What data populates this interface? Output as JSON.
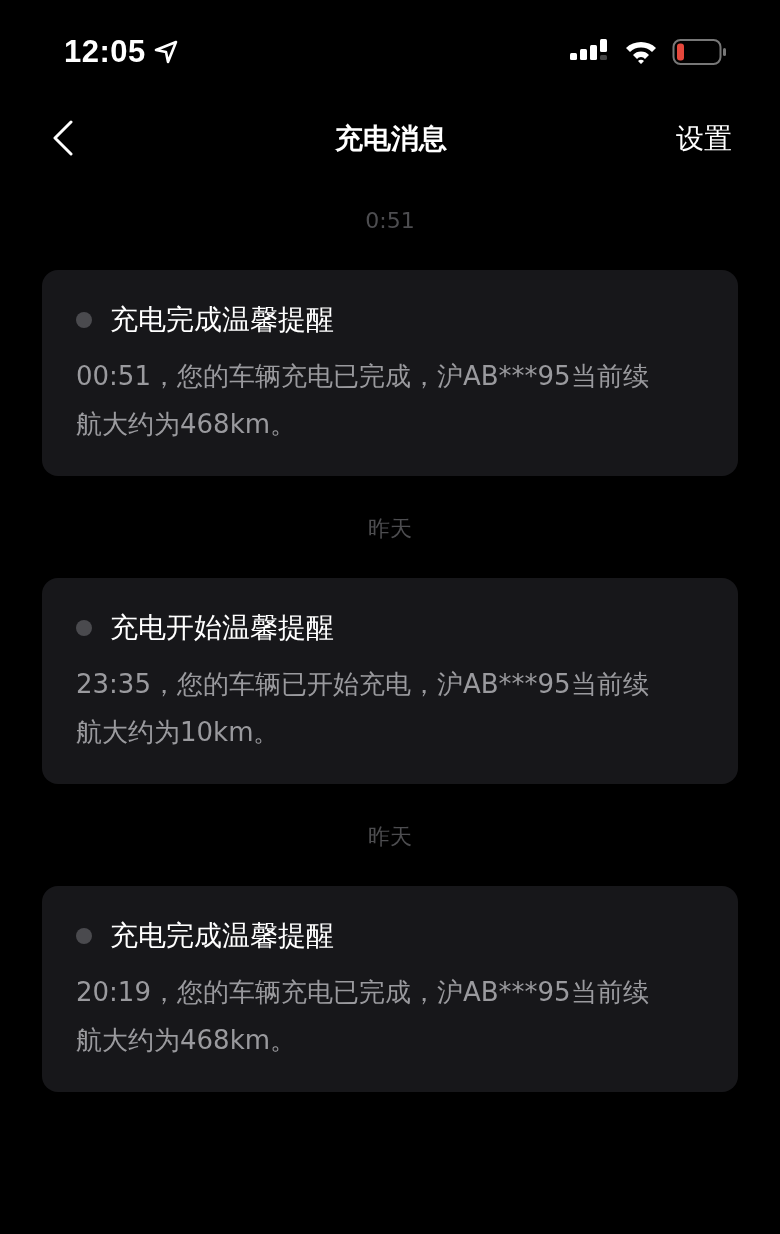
{
  "status_bar": {
    "time": "12:05"
  },
  "nav": {
    "title": "充电消息",
    "action": "设置"
  },
  "messages": [
    {
      "date": "0:51",
      "title": "充电完成温馨提醒",
      "body": "00:51，您的车辆充电已完成，沪AB***95当前续航大约为468km。"
    },
    {
      "date": "昨天",
      "title": "充电开始温馨提醒",
      "body": "23:35，您的车辆已开始充电，沪AB***95当前续航大约为10km。"
    },
    {
      "date": "昨天",
      "title": "充电完成温馨提醒",
      "body": "20:19，您的车辆充电已完成，沪AB***95当前续航大约为468km。"
    }
  ]
}
